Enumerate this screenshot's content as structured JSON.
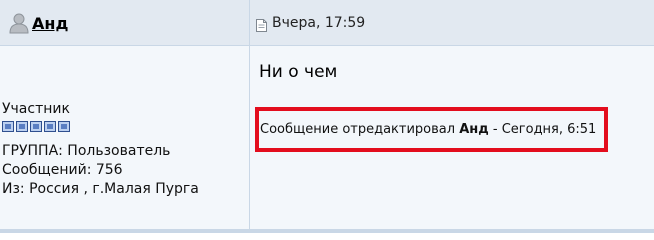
{
  "post": {
    "author": {
      "name": "Анд",
      "icon": "user-icon"
    },
    "date": {
      "icon": "document-icon",
      "text": "Вчера, 17:59"
    },
    "profile": {
      "rank": "Участник",
      "rank_pips": 5,
      "group": "ГРУППА: Пользователь",
      "messages": "Сообщений: 756",
      "from": "Из: Россия , г.Малая Пурга"
    },
    "title": "Ни о чем",
    "edit_note": {
      "prefix": "Сообщение отредактировал ",
      "editor": "Анд",
      "suffix": " - Сегодня, 6:51"
    },
    "colors": {
      "header_bg": "#e2e9f1",
      "body_bg": "#f3f7fb",
      "highlight_border": "#e30d1d",
      "pip_fill": "#5a7ec2"
    }
  }
}
